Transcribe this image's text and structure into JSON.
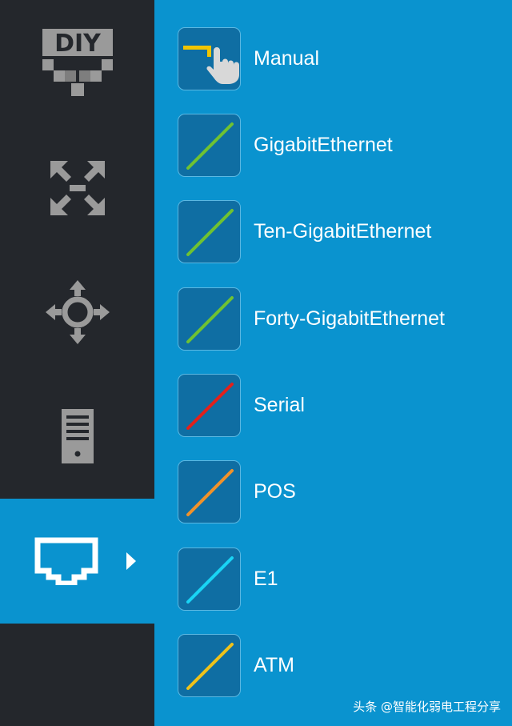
{
  "sidebar": {
    "items": [
      {
        "name": "diy-icon",
        "label": "DIY",
        "active": false
      },
      {
        "name": "switch-icon",
        "active": false
      },
      {
        "name": "router-icon",
        "active": false
      },
      {
        "name": "server-icon",
        "active": false
      },
      {
        "name": "ethernet-port-icon",
        "active": true
      }
    ]
  },
  "cables": [
    {
      "label": "Manual",
      "icon": "hand-pointer-icon",
      "color": "#f2c500"
    },
    {
      "label": "GigabitEthernet",
      "icon": "cable-line-icon",
      "color": "#6fc232"
    },
    {
      "label": "Ten-GigabitEthernet",
      "icon": "cable-line-icon",
      "color": "#6fc232"
    },
    {
      "label": "Forty-GigabitEthernet",
      "icon": "cable-line-icon",
      "color": "#6fc232"
    },
    {
      "label": "Serial",
      "icon": "cable-line-icon",
      "color": "#e3201b"
    },
    {
      "label": "POS",
      "icon": "cable-line-icon",
      "color": "#f0922b"
    },
    {
      "label": "E1",
      "icon": "cable-line-icon",
      "color": "#19d4f5"
    },
    {
      "label": "ATM",
      "icon": "cable-line-icon",
      "color": "#efc21a"
    }
  ],
  "watermark": "头条 @智能化弱电工程分享",
  "colors": {
    "sidebar_bg": "#24272c",
    "accent": "#0a93cf",
    "icon_gray": "#9a9a9a",
    "icon_box_bg": "#0f6ea3"
  }
}
